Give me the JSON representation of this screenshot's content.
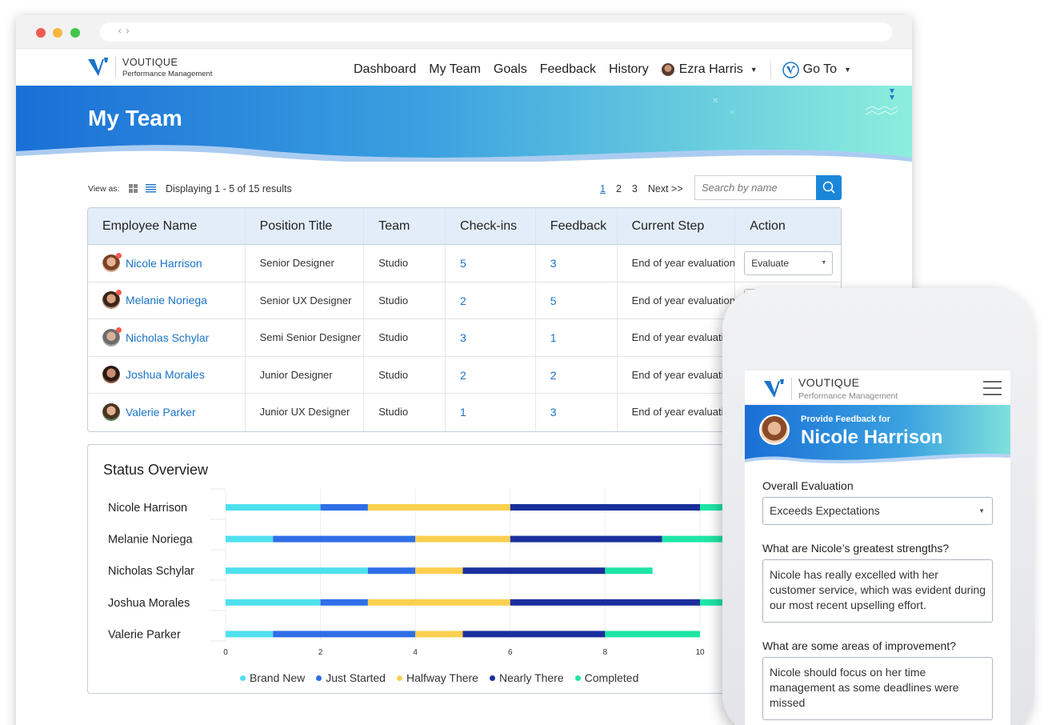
{
  "header": {
    "brand": "VOUTIQUE",
    "brand_sub": "Performance Management",
    "nav": [
      "Dashboard",
      "My Team",
      "Goals",
      "Feedback",
      "History"
    ],
    "user_name": "Ezra Harris",
    "goto_label": "Go To"
  },
  "page": {
    "title": "My Team"
  },
  "toolbar": {
    "view_as": "View as:",
    "displaying": "Displaying 1 - 5 of 15 results",
    "pages": [
      "1",
      "2",
      "3"
    ],
    "next": "Next >>",
    "search_placeholder": "Search by name"
  },
  "table": {
    "columns": [
      "Employee Name",
      "Position Title",
      "Team",
      "Check-ins",
      "Feedback",
      "Current Step",
      "Action"
    ],
    "rows": [
      {
        "name": "Nicole Harrison",
        "position": "Senior Designer",
        "team": "Studio",
        "checkins": "5",
        "feedback": "3",
        "step": "End of year evaluation",
        "action": "Evaluate"
      },
      {
        "name": "Melanie Noriega",
        "position": "Senior UX Designer",
        "team": "Studio",
        "checkins": "2",
        "feedback": "5",
        "step": "End of year evaluation",
        "action": ""
      },
      {
        "name": "Nicholas Schylar",
        "position": "Semi Senior Designer",
        "team": "Studio",
        "checkins": "3",
        "feedback": "1",
        "step": "End of year evaluation",
        "action": ""
      },
      {
        "name": "Joshua Morales",
        "position": "Junior Designer",
        "team": "Studio",
        "checkins": "2",
        "feedback": "2",
        "step": "End of year evaluation",
        "action": ""
      },
      {
        "name": "Valerie Parker",
        "position": "Junior UX Designer",
        "team": "Studio",
        "checkins": "1",
        "feedback": "3",
        "step": "End of year evaluation",
        "action": ""
      }
    ]
  },
  "status": {
    "title": "Status Overview"
  },
  "chart_data": {
    "type": "bar",
    "orientation": "horizontal",
    "stacked": true,
    "categories": [
      "Nicole Harrison",
      "Melanie Noriega",
      "Nicholas Schylar",
      "Joshua Morales",
      "Valerie Parker"
    ],
    "series": [
      {
        "name": "Brand New",
        "color": "#4fe0ee",
        "values": [
          2,
          1,
          3,
          2,
          1
        ]
      },
      {
        "name": "Just Started",
        "color": "#2f6ee6",
        "values": [
          1,
          3,
          1,
          1,
          3
        ]
      },
      {
        "name": "Halfway There",
        "color": "#fbd050",
        "values": [
          3,
          2,
          1,
          3,
          1
        ]
      },
      {
        "name": "Nearly There",
        "color": "#1a2f9c",
        "values": [
          4,
          3.2,
          3,
          4,
          3
        ]
      },
      {
        "name": "Completed",
        "color": "#1ee6a4",
        "values": [
          1,
          2,
          1,
          1,
          2
        ]
      }
    ],
    "xticks": [
      "0",
      "2",
      "4",
      "6",
      "8",
      "10"
    ],
    "xlim": [
      0,
      12
    ],
    "grid": true,
    "legend": "bottom"
  },
  "mobile": {
    "brand": "VOUTIQUE",
    "brand_sub": "Performance Management",
    "provide_for": "Provide Feedback for",
    "employee": "Nicole Harrison",
    "overall_label": "Overall Evaluation",
    "overall_value": "Exceeds Expectations",
    "strengths_label": "What are Nicole’s greatest strengths?",
    "strengths_value": "Nicole has really excelled with her customer service, which was evident during our most recent upselling effort.",
    "improve_label": "What are some areas of improvement?",
    "improve_value": "Nicole should focus on her time management as some deadlines were missed"
  },
  "colors": {
    "accent": "#1a73c8",
    "banner_start": "#1a6fd6",
    "banner_end": "#7ee8d8"
  }
}
